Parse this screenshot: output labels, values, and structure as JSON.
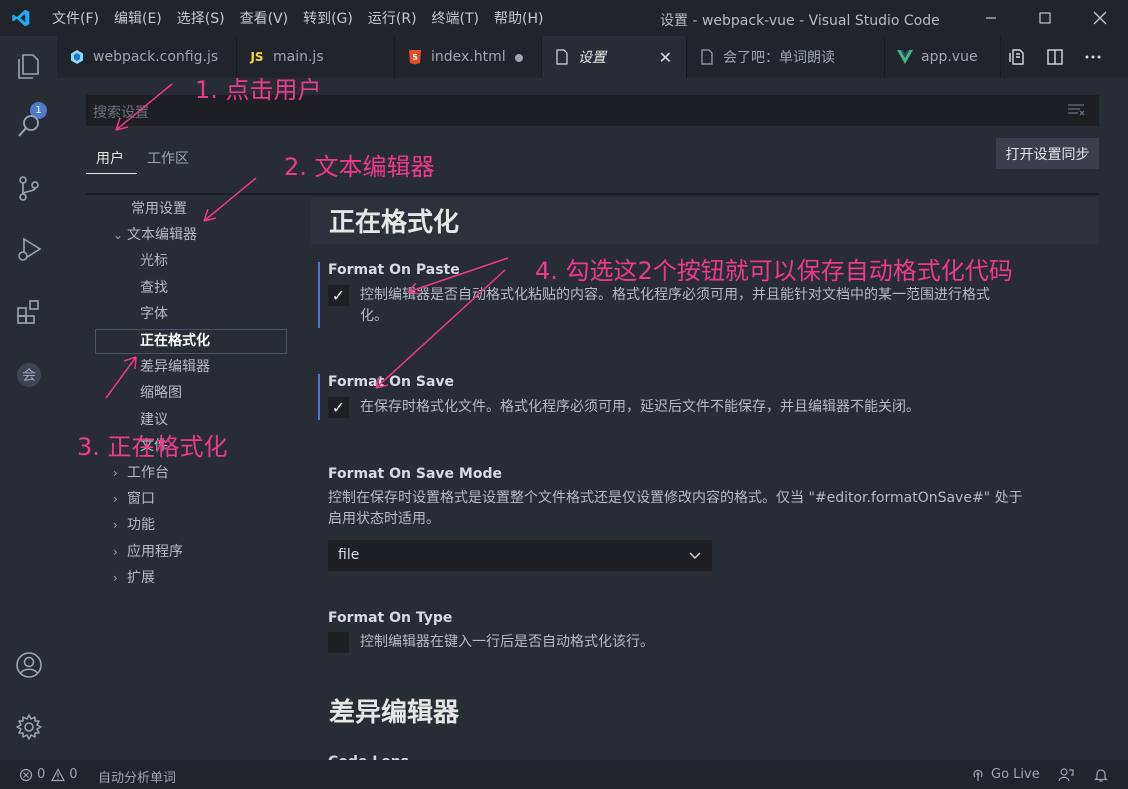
{
  "menu": [
    "文件(F)",
    "编辑(E)",
    "选择(S)",
    "查看(V)",
    "转到(G)",
    "运行(R)",
    "终端(T)",
    "帮助(H)"
  ],
  "window_title": "设置 - webpack-vue - Visual Studio Code",
  "activity_badge": "1",
  "tabs": [
    {
      "label": "webpack.config.js",
      "icon": "webpack-icon"
    },
    {
      "label": "main.js",
      "icon": "js-icon",
      "icon_text": "JS"
    },
    {
      "label": "index.html",
      "icon": "html5-icon",
      "dirty": true
    },
    {
      "label": "设置",
      "icon": "file-icon",
      "active": true
    },
    {
      "label": "会了吧：单词朗读",
      "icon": "file-icon"
    },
    {
      "label": "app.vue",
      "icon": "vue-icon"
    }
  ],
  "search": {
    "placeholder": "搜索设置"
  },
  "scopes": {
    "user": "用户",
    "workspace": "工作区"
  },
  "sync_button": "打开设置同步",
  "toc": {
    "common": "常用设置",
    "text_editor": "文本编辑器",
    "cursor": "光标",
    "find": "查找",
    "font": "字体",
    "formatting": "正在格式化",
    "diff_editor": "差异编辑器",
    "minimap": "缩略图",
    "suggestions": "建议",
    "files": "文件",
    "workbench": "工作台",
    "window": "窗口",
    "features": "功能",
    "application": "应用程序",
    "extensions": "扩展"
  },
  "section_title": "正在格式化",
  "settings": {
    "format_on_paste": {
      "title": "Format On Paste",
      "desc_line1": "控制编辑器是否自动格式化粘贴的内容。格式化程序必须可用，并且能针对文档中的某一范围进行格式",
      "desc_line2": "化。",
      "checked": true
    },
    "format_on_save": {
      "title": "Format On Save",
      "desc": "在保存时格式化文件。格式化程序必须可用，延迟后文件不能保存，并且编辑器不能关闭。",
      "checked": true
    },
    "format_on_save_mode": {
      "title": "Format On Save Mode",
      "desc_line1": "控制在保存时设置格式是设置整个文件格式还是仅设置修改内容的格式。仅当 \"#editor.formatOnSave#\" 处于",
      "desc_line2": "启用状态时适用。",
      "value": "file"
    },
    "format_on_type": {
      "title": "Format On Type",
      "desc": "控制编辑器在键入一行后是否自动格式化该行。",
      "checked": false
    }
  },
  "next_section_title": "差异编辑器",
  "next_setting_title": "Code Lens",
  "annotations": {
    "step1": "1. 点击用户",
    "step2": "2. 文本编辑器",
    "step3": "3. 正在格式化",
    "step4": "4. 勾选这2个按钮就可以保存自动格式化代码"
  },
  "status": {
    "errors": "0",
    "warnings": "0",
    "extension_text": "自动分析单词",
    "golive": "Go Live"
  },
  "colors": {
    "accent": "#4d78cc",
    "annotation": "#ec3b8b",
    "vscode_blue": "#23a9f2",
    "vue_green": "#41b883",
    "html_orange": "#e44d26",
    "js_yellow": "#f1dd35"
  }
}
